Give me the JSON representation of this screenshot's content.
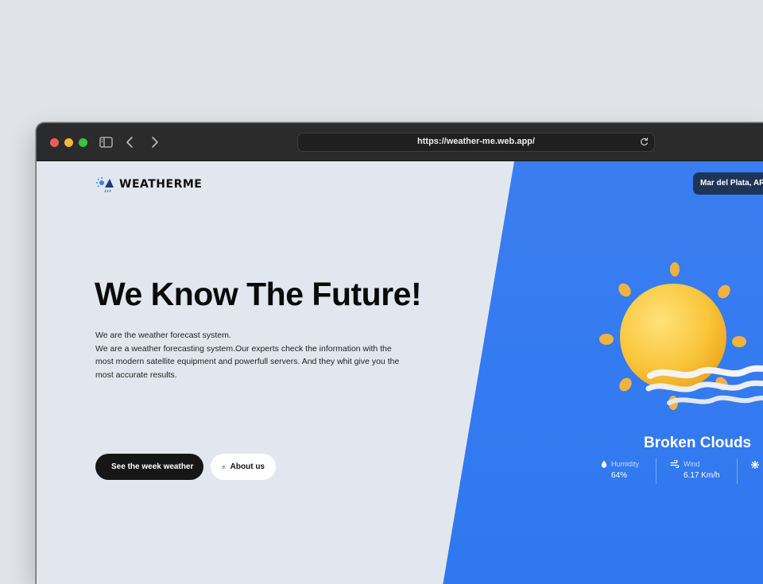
{
  "browser": {
    "url": "https://weather-me.web.app/"
  },
  "site": {
    "brand": "WEATHERME",
    "location": "Mar del Plata, AR"
  },
  "hero": {
    "title": "We Know The Future!",
    "description_lines": [
      "We are the weather forecast system.",
      "We are a weather forecasting system.Our experts check the information with the most modern satellite equipment and powerfull servers. And they whit give you the most accurate results."
    ],
    "buttons": {
      "week_weather": "See the week weather",
      "about": "About us"
    }
  },
  "weather": {
    "condition": "Broken Clouds",
    "humidity_label": "Humidity",
    "humidity_value": "64%",
    "wind_label": "Wind",
    "wind_value": "6.17 Km/h"
  },
  "colors": {
    "accent_blue": "#3a7df0",
    "page_bg": "#e2e7ef",
    "dark_button": "#161616",
    "location_pill": "#1e3556"
  },
  "icons": {
    "brand": "weather-logo-icon",
    "humidity": "droplet-icon",
    "wind": "wind-icon",
    "extra": "gear-icon",
    "week_button": "circle-icon",
    "about_button": "users-icon"
  }
}
